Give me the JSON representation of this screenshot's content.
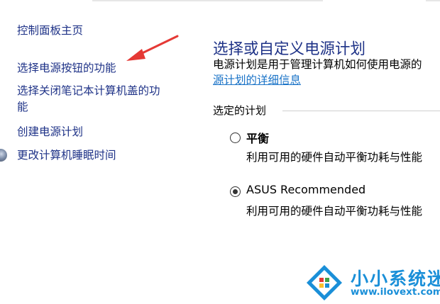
{
  "nav": {
    "home": "控制面板主页",
    "power_buttons": "选择电源按钮的功能",
    "lid_line1": "选择关闭笔记本计算机盖的功",
    "lid_line2": "能",
    "create_plan": "创建电源计划",
    "sleep": "更改计算机睡眠时间"
  },
  "main": {
    "title": "选择或自定义电源计划",
    "description": "电源计划是用于管理计算机如何使用电源的",
    "description_link": "源计划的详细信息",
    "group_label": "选定的计划",
    "plans": [
      {
        "name": "平衡",
        "description": "利用可用的硬件自动平衡功耗与性能",
        "selected": false
      },
      {
        "name": "ASUS Recommended",
        "description": "利用可用的硬件自动平衡功耗与性能",
        "selected": true
      }
    ]
  },
  "watermark": {
    "name": "小小系统迷",
    "url": "www.ilovext.com"
  },
  "colors": {
    "link": "#1e3287",
    "hyperlink": "#1a73c7",
    "annotation_arrow": "#e53935",
    "watermark": "#1a8fd8"
  }
}
